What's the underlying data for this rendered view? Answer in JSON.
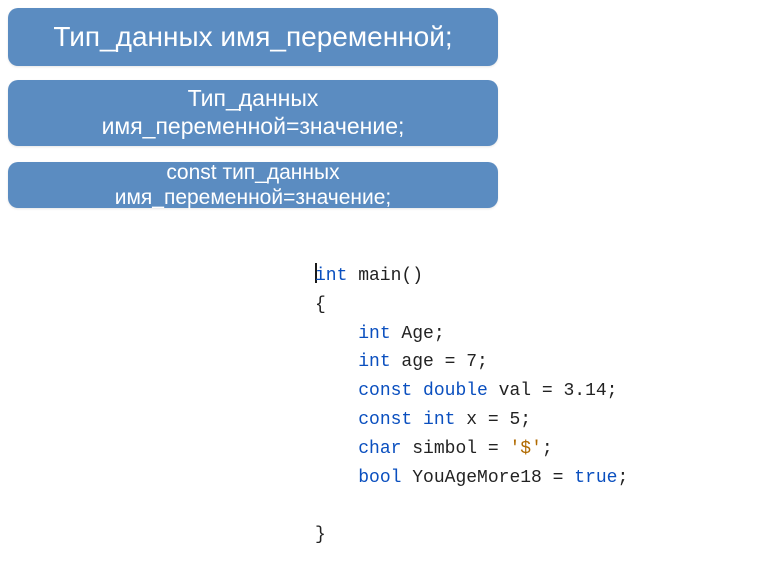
{
  "bubbles": {
    "b1": "Тип_данных имя_переменной;",
    "b2_line1": "Тип_данных",
    "b2_line2": "имя_переменной=значение;",
    "b3": "const тип_данных имя_переменной=значение;"
  },
  "code": {
    "sig_kw": "int",
    "sig_rest": " main()",
    "open_brace": "{",
    "l1_kw": "int",
    "l1_rest": " Age;",
    "l2_kw": "int",
    "l2_rest": " age = 7;",
    "l3_kw1": "const",
    "l3_kw2": " double",
    "l3_rest": " val = 3.14;",
    "l4_kw1": "const",
    "l4_kw2": " int",
    "l4_rest": " x = 5;",
    "l5_kw": "char",
    "l5_mid": " simbol = ",
    "l5_lit": "'$'",
    "l5_end": ";",
    "l6_kw": "bool",
    "l6_mid": " YouAgeMore18 = ",
    "l6_lit": "true",
    "l6_end": ";",
    "close_brace": "}"
  }
}
